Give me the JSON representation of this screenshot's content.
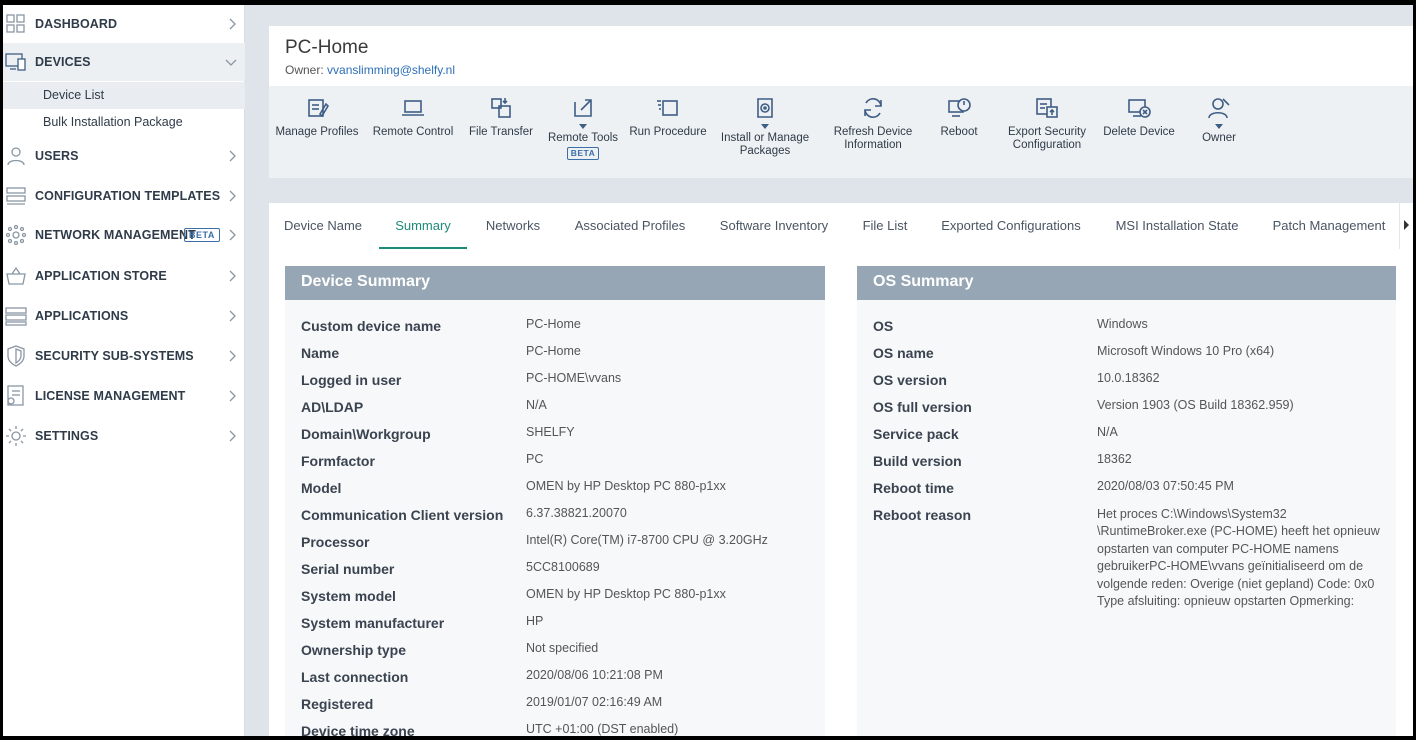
{
  "sidebar": {
    "items": [
      {
        "label": "DASHBOARD"
      },
      {
        "label": "DEVICES"
      },
      {
        "label": "USERS"
      },
      {
        "label": "CONFIGURATION TEMPLATES"
      },
      {
        "label": "NETWORK MANAGEMENT",
        "badge": "BETA"
      },
      {
        "label": "APPLICATION STORE"
      },
      {
        "label": "APPLICATIONS"
      },
      {
        "label": "SECURITY SUB-SYSTEMS"
      },
      {
        "label": "LICENSE MANAGEMENT"
      },
      {
        "label": "SETTINGS"
      }
    ],
    "devices_sub": [
      {
        "label": "Device List"
      },
      {
        "label": "Bulk Installation Package"
      }
    ]
  },
  "header": {
    "title": "PC-Home",
    "owner_prefix": "Owner: ",
    "owner_email": "vvanslimming@shelfy.nl"
  },
  "toolbar": {
    "items": [
      {
        "label": "Manage Profiles",
        "icon": "manage-profiles-icon"
      },
      {
        "label": "Remote Control",
        "icon": "laptop-icon"
      },
      {
        "label": "File Transfer",
        "icon": "file-transfer-icon"
      },
      {
        "label": "Remote Tools",
        "icon": "remote-tools-icon",
        "badge": "BETA"
      },
      {
        "label": "Run Procedure",
        "icon": "run-procedure-icon"
      },
      {
        "label": "Install or Manage Packages",
        "icon": "package-icon"
      },
      {
        "label": "Refresh Device Information",
        "icon": "refresh-icon"
      },
      {
        "label": "Reboot",
        "icon": "reboot-icon"
      },
      {
        "label": "Export Security Configuration",
        "icon": "export-icon"
      },
      {
        "label": "Delete Device",
        "icon": "delete-device-icon"
      },
      {
        "label": "Owner",
        "icon": "owner-icon"
      }
    ]
  },
  "tabs": [
    {
      "label": "Device Name"
    },
    {
      "label": "Summary"
    },
    {
      "label": "Networks"
    },
    {
      "label": "Associated Profiles"
    },
    {
      "label": "Software Inventory"
    },
    {
      "label": "File List"
    },
    {
      "label": "Exported Configurations"
    },
    {
      "label": "MSI Installation State"
    },
    {
      "label": "Patch Management"
    }
  ],
  "device_summary": {
    "title": "Device Summary",
    "rows": [
      {
        "k": "Custom device name",
        "v": "PC-Home"
      },
      {
        "k": "Name",
        "v": "PC-Home"
      },
      {
        "k": "Logged in user",
        "v": "PC-HOME\\vvans"
      },
      {
        "k": "AD\\LDAP",
        "v": "N/A"
      },
      {
        "k": "Domain\\Workgroup",
        "v": "SHELFY"
      },
      {
        "k": "Formfactor",
        "v": "PC"
      },
      {
        "k": "Model",
        "v": "OMEN by HP Desktop PC 880-p1xx"
      },
      {
        "k": "Communication Client version",
        "v": "6.37.38821.20070"
      },
      {
        "k": "Processor",
        "v": "Intel(R) Core(TM) i7-8700 CPU @ 3.20GHz"
      },
      {
        "k": "Serial number",
        "v": "5CC8100689"
      },
      {
        "k": "System model",
        "v": "OMEN by HP Desktop PC 880-p1xx"
      },
      {
        "k": "System manufacturer",
        "v": "HP"
      },
      {
        "k": "Ownership type",
        "v": "Not specified"
      },
      {
        "k": "Last connection",
        "v": "2020/08/06 10:21:08 PM"
      },
      {
        "k": "Registered",
        "v": "2019/01/07 02:16:49 AM"
      },
      {
        "k": "Device time zone",
        "v": "UTC +01:00 (DST enabled)"
      }
    ]
  },
  "os_summary": {
    "title": "OS Summary",
    "rows": [
      {
        "k": "OS",
        "v": "Windows"
      },
      {
        "k": "OS name",
        "v": "Microsoft Windows 10 Pro (x64)"
      },
      {
        "k": "OS version",
        "v": "10.0.18362"
      },
      {
        "k": "OS full version",
        "v": "Version 1903 (OS Build 18362.959)"
      },
      {
        "k": "Service pack",
        "v": "N/A"
      },
      {
        "k": "Build version",
        "v": "18362"
      },
      {
        "k": "Reboot time",
        "v": "2020/08/03 07:50:45 PM"
      },
      {
        "k": "Reboot reason",
        "v": "Het proces C:\\Windows\\System32 \\RuntimeBroker.exe (PC-HOME) heeft het opnieuw opstarten van computer PC-HOME namens gebruikerPC-HOME\\vvans geïnitialiseerd om de volgende reden: Overige (niet gepland) Code: 0x0 Type afsluiting: opnieuw opstarten Opmerking:"
      }
    ]
  },
  "colors": {
    "accent": "#1e8a7a",
    "link": "#2c6fb7",
    "panel_header": "#97a6b4",
    "icon": "#3f5e86"
  }
}
